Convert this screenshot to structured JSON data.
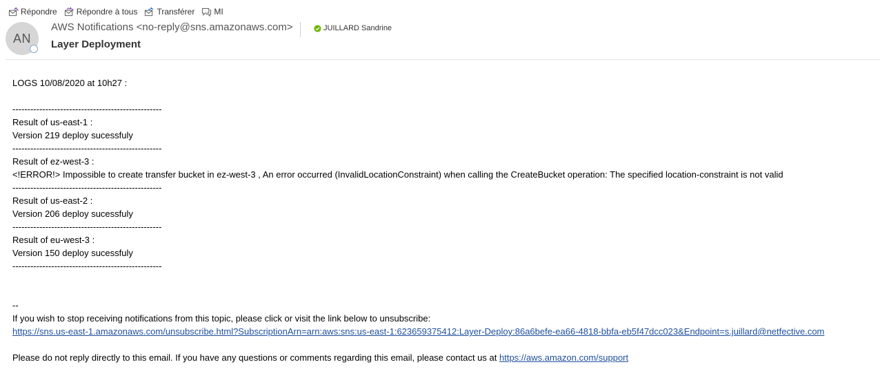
{
  "toolbar": {
    "reply": {
      "label": "Répondre",
      "icon": "reply-icon"
    },
    "reply_all": {
      "label": "Répondre à tous",
      "icon": "reply-all-icon"
    },
    "forward": {
      "label": "Transférer",
      "icon": "forward-icon"
    },
    "im": {
      "label": "MI",
      "icon": "instant-message-icon"
    }
  },
  "header": {
    "avatar_initials": "AN",
    "sender": "AWS Notifications <no-reply@sns.amazonaws.com>",
    "recipient": "JUILLARD Sandrine",
    "recipient_status_color": "#6bb700",
    "subject": "Layer Deployment"
  },
  "body": {
    "logs_title": "LOGS 10/08/2020 at 10h27 :",
    "separator": "--------------------------------------------------",
    "results": [
      {
        "heading": "Result of us-east-1 :",
        "message": "Version 219 deploy sucessfuly"
      },
      {
        "heading": "Result of ez-west-3 :",
        "message": "<!ERROR!> Impossible to create transfer bucket in ez-west-3 , An error occurred (InvalidLocationConstraint) when calling the CreateBucket operation: The specified location-constraint is not valid"
      },
      {
        "heading": "Result of us-east-2 :",
        "message": "Version 206 deploy sucessfuly"
      },
      {
        "heading": "Result of eu-west-3 :",
        "message": "Version 150 deploy sucessfuly"
      }
    ],
    "sig_dash": "--",
    "unsubscribe_text": "If you wish to stop receiving notifications from this topic, please click or visit the link below to unsubscribe:",
    "unsubscribe_link": "https://sns.us-east-1.amazonaws.com/unsubscribe.html?SubscriptionArn=arn:aws:sns:us-east-1:623659375412:Layer-Deploy:86a6befe-ea66-4818-bbfa-eb5f47dcc023&Endpoint=s.juillard@netfective.com",
    "contact_text": "Please do not reply directly to this email. If you have any questions or comments regarding this email, please contact us at ",
    "support_link": "https://aws.amazon.com/support"
  }
}
